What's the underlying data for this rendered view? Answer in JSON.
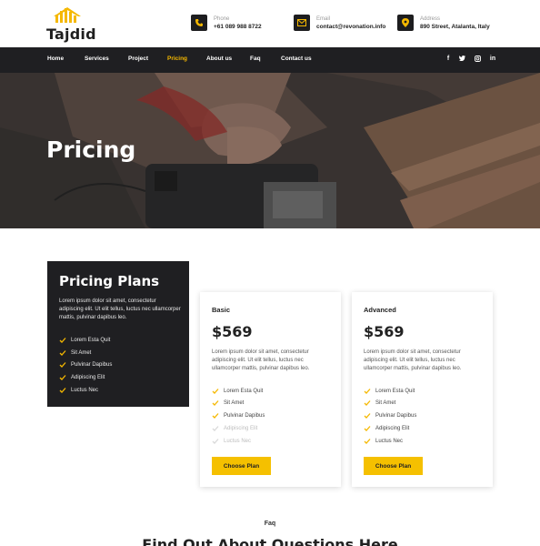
{
  "brand": {
    "name": "Tajdid",
    "accent": "#f5b800",
    "dark": "#1f1f22"
  },
  "contacts": [
    {
      "icon": "phone-icon",
      "label": "Phone",
      "value": "+61 089 988 8722"
    },
    {
      "icon": "email-icon",
      "label": "Email",
      "value": "contact@revonation.info"
    },
    {
      "icon": "location-icon",
      "label": "Address",
      "value": "890 Street, Atalanta, Italy"
    }
  ],
  "nav": {
    "items": [
      "Home",
      "Services",
      "Project",
      "Pricing",
      "About us",
      "Faq",
      "Contact us"
    ],
    "active": "Pricing",
    "social": [
      "f",
      "t",
      "ig",
      "in"
    ]
  },
  "hero": {
    "title": "Pricing"
  },
  "plans": {
    "title": "Pricing Plans",
    "description": "Lorem ipsum dolor sit amet, consectetur adipiscing elit. Ut elit tellus, luctus nec ullamcorper mattis, pulvinar dapibus leo.",
    "features": [
      "Lorem Esta Quit",
      "Sit Amet",
      "Pulvinar Dapibus",
      "Adipiscing Elit",
      "Luctus Nec"
    ]
  },
  "cards": [
    {
      "name": "Basic",
      "price": "$569",
      "description": "Lorem ipsum dolor sit amet, consectetur adipiscing elit. Ut elit tellus, luctus nec ullamcorper mattis, pulvinar dapibus leo.",
      "features": [
        "Lorem Esta Quit",
        "Sit Amet",
        "Pulvinar Dapibus",
        "Adipiscing Elit",
        "Luctus Nec"
      ],
      "features_included": [
        true,
        true,
        true,
        false,
        false
      ],
      "button": "Choose Plan"
    },
    {
      "name": "Advanced",
      "price": "$569",
      "description": "Lorem ipsum dolor sit amet, consectetur adipiscing elit. Ut elit tellus, luctus nec ullamcorper mattis, pulvinar dapibus leo.",
      "features": [
        "Lorem Esta Quit",
        "Sit Amet",
        "Pulvinar Dapibus",
        "Adipiscing Elit",
        "Luctus Nec"
      ],
      "features_included": [
        true,
        true,
        true,
        true,
        true
      ],
      "button": "Choose Plan"
    }
  ],
  "faq": {
    "label": "Faq",
    "title": "Find Out About Questions Here"
  }
}
